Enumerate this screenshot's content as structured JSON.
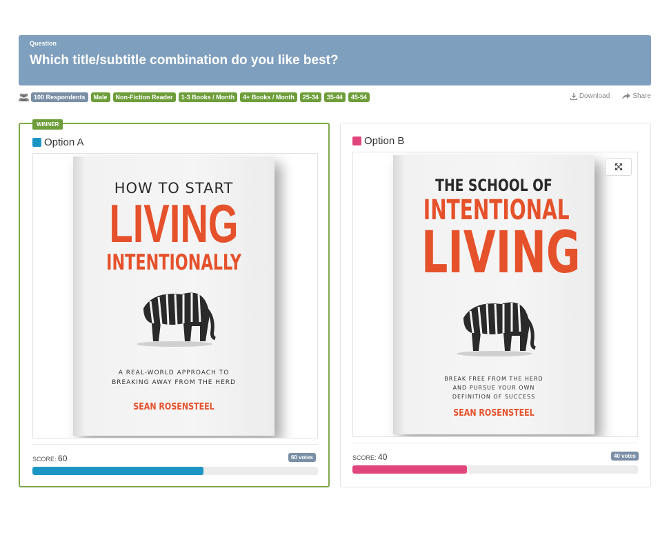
{
  "question": {
    "label": "Question",
    "text": "Which title/subtitle combination do you like best?"
  },
  "tags": [
    {
      "text": "100 Respondents",
      "style": "gray"
    },
    {
      "text": "Male",
      "style": "green"
    },
    {
      "text": "Non-Fiction Reader",
      "style": "green"
    },
    {
      "text": "1-3 Books / Month",
      "style": "green"
    },
    {
      "text": "4+ Books / Month",
      "style": "green"
    },
    {
      "text": "25-34",
      "style": "green"
    },
    {
      "text": "35-44",
      "style": "green"
    },
    {
      "text": "45-54",
      "style": "green"
    }
  ],
  "actions": {
    "download": "Download",
    "share": "Share"
  },
  "winner_label": "WINNER",
  "colors": {
    "option_a": "#1b96c4",
    "option_b": "#e0457b",
    "accent_red": "#e5512b",
    "winner_green": "#6e9e3a"
  },
  "options": [
    {
      "title": "Option A",
      "book": {
        "line1": "HOW TO START",
        "line2": "LIVING",
        "line3": "INTENTIONALLY",
        "subtitle1": "A REAL-WORLD APPROACH TO",
        "subtitle2": "BREAKING AWAY FROM THE HERD",
        "author": "SEAN ROSENSTEEL"
      },
      "score_label": "SCORE:",
      "score": "60",
      "score_fraction": 0.6,
      "votes": "60 votes"
    },
    {
      "title": "Option B",
      "book": {
        "line1": "THE SCHOOL OF",
        "line2": "INTENTIONAL",
        "line3": "LIVING",
        "subtitle1": "BREAK FREE FROM THE HERD",
        "subtitle2": "AND PURSUE YOUR OWN",
        "subtitle3": "DEFINITION OF SUCCESS",
        "author": "SEAN ROSENSTEEL"
      },
      "score_label": "SCORE:",
      "score": "40",
      "score_fraction": 0.4,
      "votes": "40 votes"
    }
  ]
}
